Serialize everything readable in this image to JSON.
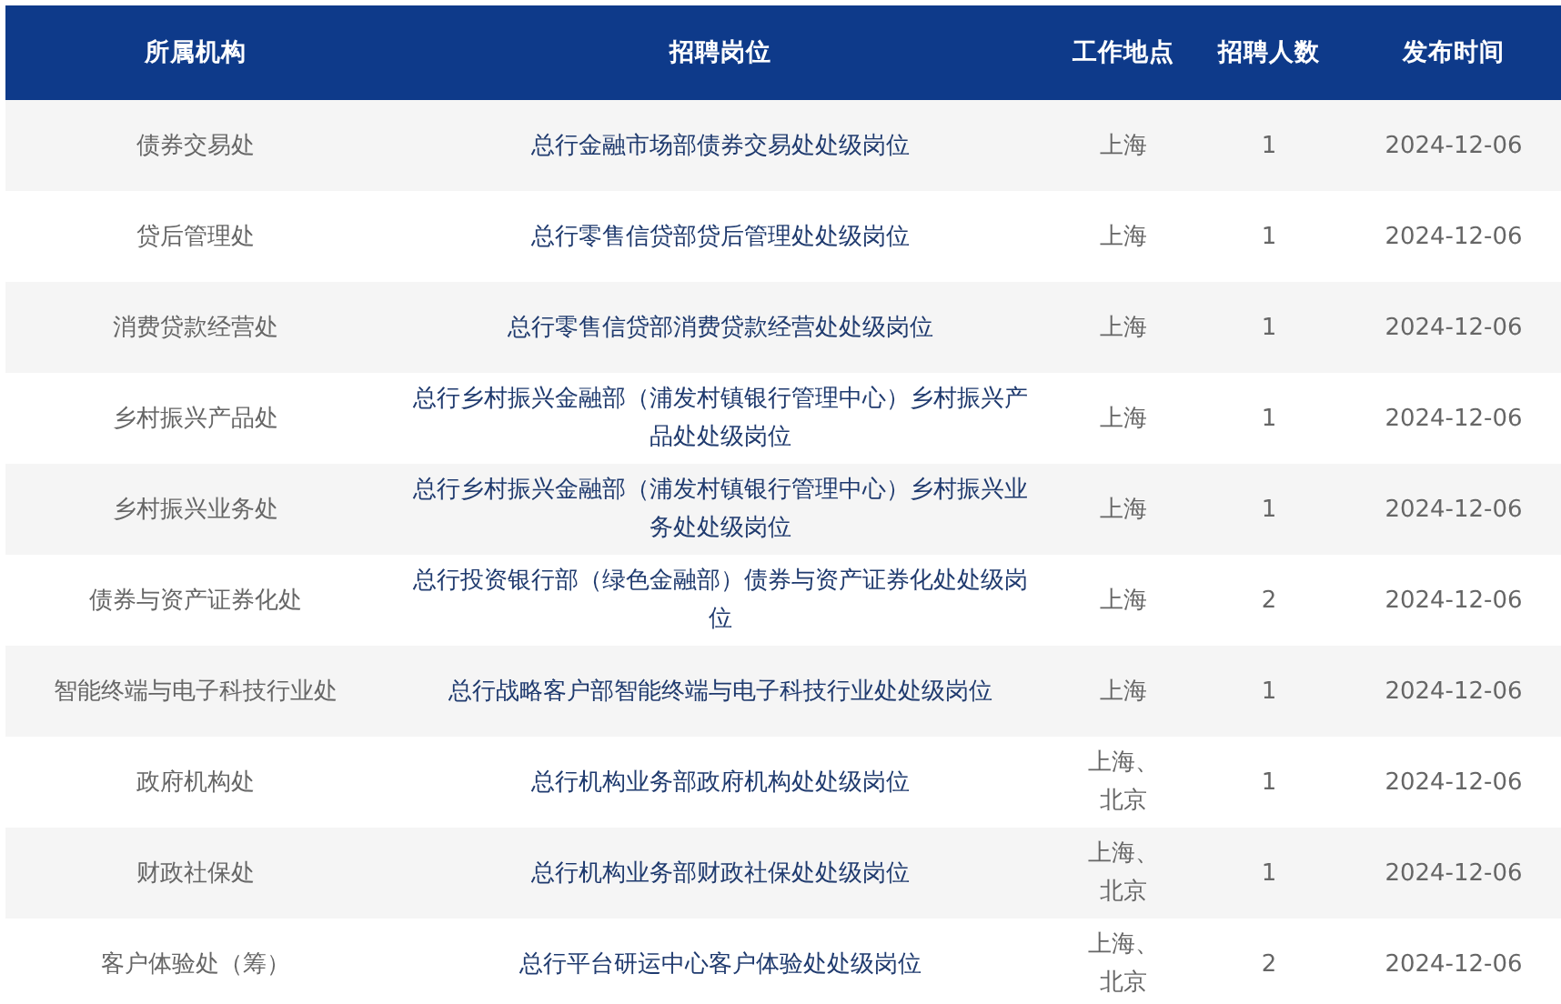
{
  "table": {
    "columns": [
      "所属机构",
      "招聘岗位",
      "工作地点",
      "招聘人数",
      "发布时间"
    ],
    "rows": [
      [
        "债券交易处",
        "总行金融市场部债券交易处处级岗位",
        "上海",
        "1",
        "2024-12-06"
      ],
      [
        "贷后管理处",
        "总行零售信贷部贷后管理处处级岗位",
        "上海",
        "1",
        "2024-12-06"
      ],
      [
        "消费贷款经营处",
        "总行零售信贷部消费贷款经营处处级岗位",
        "上海",
        "1",
        "2024-12-06"
      ],
      [
        "乡村振兴产品处",
        "总行乡村振兴金融部（浦发村镇银行管理中心）乡村振兴产品处处级岗位",
        "上海",
        "1",
        "2024-12-06"
      ],
      [
        "乡村振兴业务处",
        "总行乡村振兴金融部（浦发村镇银行管理中心）乡村振兴业务处处级岗位",
        "上海",
        "1",
        "2024-12-06"
      ],
      [
        "债券与资产证券化处",
        "总行投资银行部（绿色金融部）债券与资产证券化处处级岗位",
        "上海",
        "2",
        "2024-12-06"
      ],
      [
        "智能终端与电子科技行业处",
        "总行战略客户部智能终端与电子科技行业处处级岗位",
        "上海",
        "1",
        "2024-12-06"
      ],
      [
        "政府机构处",
        "总行机构业务部政府机构处处级岗位",
        "上海、北京",
        "1",
        "2024-12-06"
      ],
      [
        "财政社保处",
        "总行机构业务部财政社保处处级岗位",
        "上海、北京",
        "1",
        "2024-12-06"
      ],
      [
        "客户体验处（筹）",
        "总行平台研运中心客户体验处处级岗位",
        "上海、北京",
        "2",
        "2024-12-06"
      ]
    ]
  }
}
